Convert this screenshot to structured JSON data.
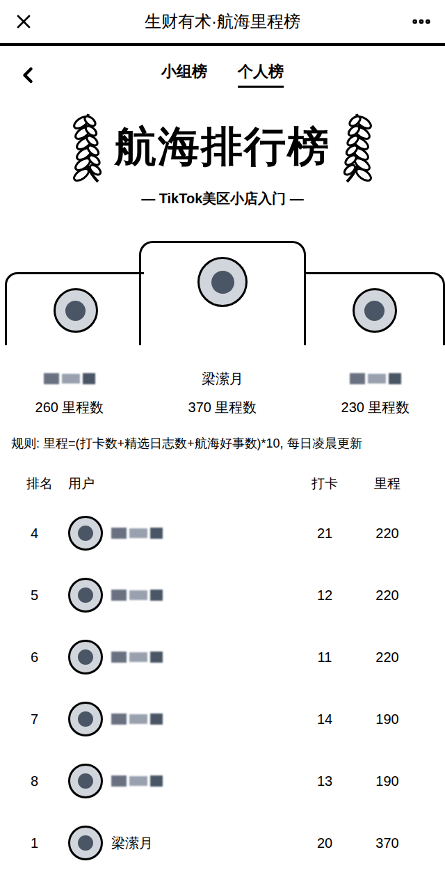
{
  "window": {
    "title": "生财有术·航海里程榜"
  },
  "tabs": [
    {
      "label": "小组榜",
      "selected": false
    },
    {
      "label": "个人榜",
      "selected": true
    }
  ],
  "banner": {
    "title": "航海排行榜",
    "subtitle": "— TikTok美区小店入门 —"
  },
  "podium": [
    {
      "kind": "side",
      "name": "",
      "name_hidden": true,
      "mileage": "260 里程数"
    },
    {
      "kind": "center",
      "name": "梁潆月",
      "name_hidden": false,
      "mileage": "370 里程数"
    },
    {
      "kind": "side",
      "name": "",
      "name_hidden": true,
      "mileage": "230 里程数"
    }
  ],
  "rule": "规则: 里程=(打卡数+精选日志数+航海好事数)*10, 每日凌晨更新",
  "table": {
    "columns": [
      "排名",
      "用户",
      "打卡",
      "里程"
    ],
    "rows": [
      {
        "rank": "4",
        "name": "",
        "name_hidden": true,
        "checkins": "21",
        "mileage": "220"
      },
      {
        "rank": "5",
        "name": "",
        "name_hidden": true,
        "checkins": "12",
        "mileage": "220"
      },
      {
        "rank": "6",
        "name": "",
        "name_hidden": true,
        "checkins": "11",
        "mileage": "220"
      },
      {
        "rank": "7",
        "name": "",
        "name_hidden": true,
        "checkins": "14",
        "mileage": "190"
      },
      {
        "rank": "8",
        "name": "",
        "name_hidden": true,
        "checkins": "13",
        "mileage": "190"
      },
      {
        "rank": "1",
        "name": "梁潆月",
        "name_hidden": false,
        "checkins": "20",
        "mileage": "370"
      }
    ]
  }
}
